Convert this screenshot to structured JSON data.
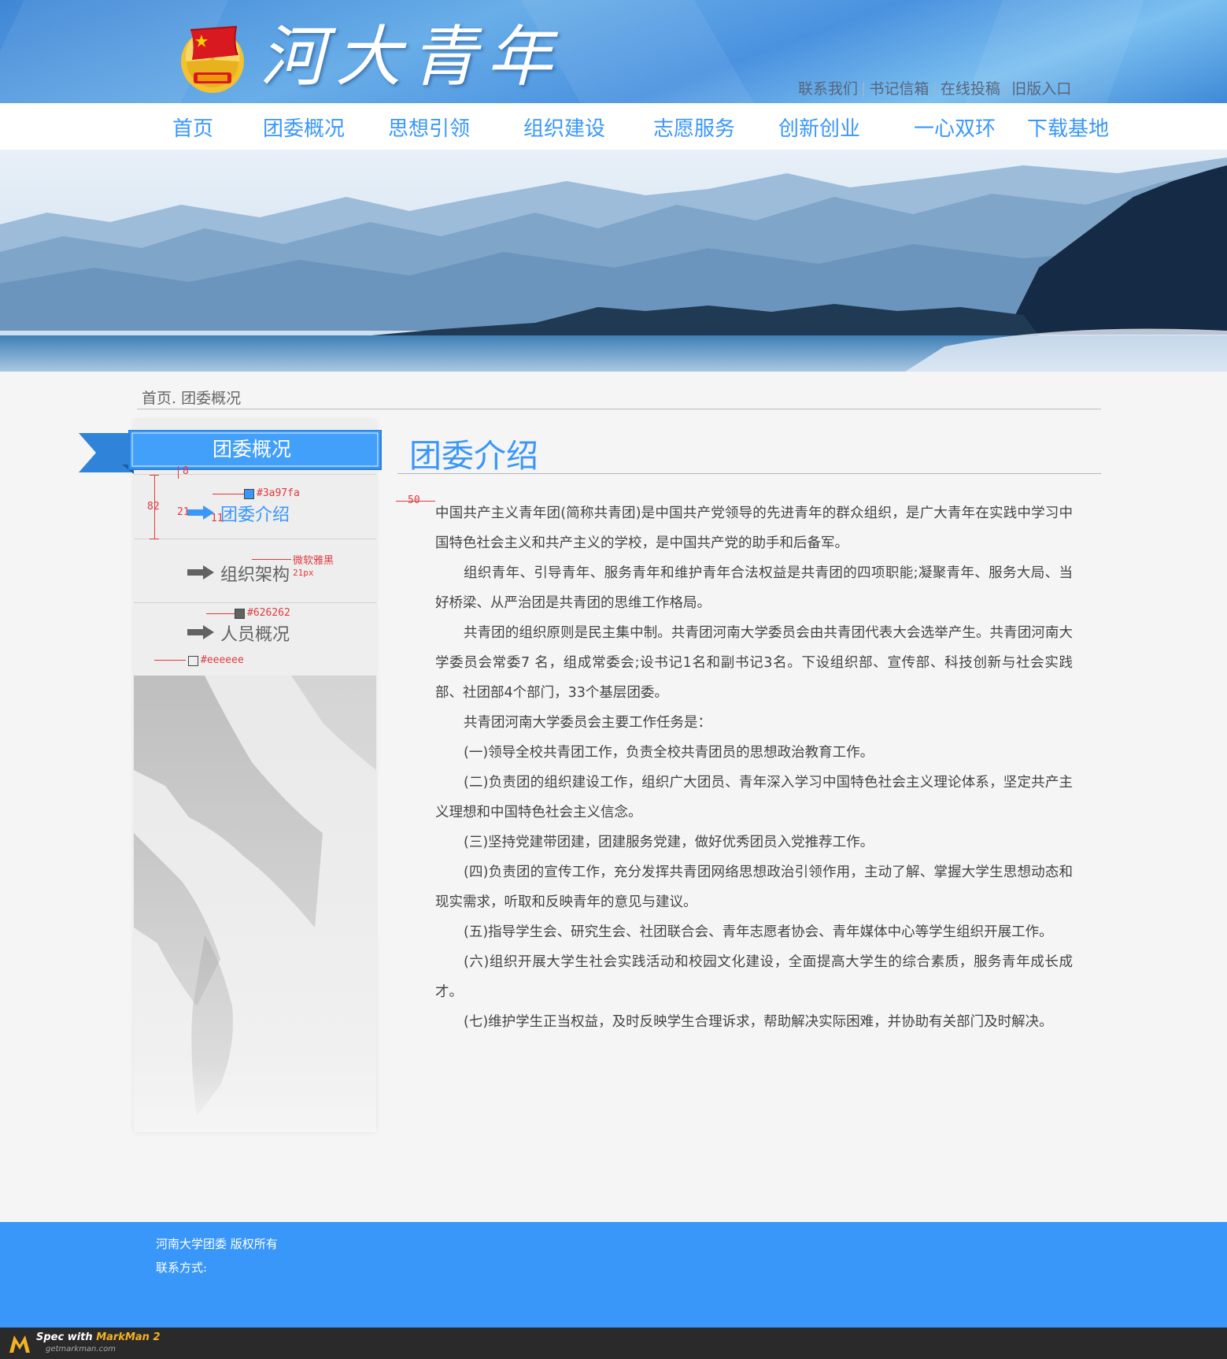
{
  "header": {
    "site_title": "河大青年",
    "top_links": [
      "联系我们",
      "书记信箱",
      "在线投稿",
      "旧版入口"
    ]
  },
  "nav": {
    "items": [
      "首页",
      "团委概况",
      "思想引领",
      "组织建设",
      "志愿服务",
      "创新创业",
      "一心双环",
      "下载基地"
    ]
  },
  "breadcrumb": "首页. 团委概况",
  "sidebar": {
    "title": "团委概况",
    "items": [
      {
        "label": "团委介绍",
        "active": true
      },
      {
        "label": "组织架构",
        "active": false
      },
      {
        "label": "人员概况",
        "active": false
      }
    ]
  },
  "spec_annotations": {
    "gap_top": "8",
    "item_height": "82",
    "arrow_left": "21",
    "arrow_gap": "11",
    "active_color": "#3a97fa",
    "font_name": "微软雅黑",
    "font_size": "21px",
    "text_color": "#626262",
    "bg_color": "#eeeeee",
    "content_indent": "50"
  },
  "content": {
    "title": "团委介绍",
    "paragraphs": [
      "中国共产主义青年团(简称共青团)是中国共产党领导的先进青年的群众组织，是广大青年在实践中学习中国特色社会主义和共产主义的学校，是中国共产党的助手和后备军。",
      "组织青年、引导青年、服务青年和维护青年合法权益是共青团的四项职能;凝聚青年、服务大局、当好桥梁、从严治团是共青团的思维工作格局。",
      "共青团的组织原则是民主集中制。共青团河南大学委员会由共青团代表大会选举产生。共青团河南大学委员会常委7 名，组成常委会;设书记1名和副书记3名。下设组织部、宣传部、科技创新与社会实践部、社团部4个部门，33个基层团委。",
      "共青团河南大学委员会主要工作任务是：",
      "(一)领导全校共青团工作，负责全校共青团员的思想政治教育工作。",
      "(二)负责团的组织建设工作，组织广大团员、青年深入学习中国特色社会主义理论体系，坚定共产主义理想和中国特色社会主义信念。",
      "(三)坚持党建带团建，团建服务党建，做好优秀团员入党推荐工作。",
      "(四)负责团的宣传工作，充分发挥共青团网络思想政治引领作用，主动了解、掌握大学生思想动态和现实需求，听取和反映青年的意见与建议。",
      "(五)指导学生会、研究生会、社团联合会、青年志愿者协会、青年媒体中心等学生组织开展工作。",
      "(六)组织开展大学生社会实践活动和校园文化建设，全面提高大学生的综合素质，服务青年成长成才。",
      "(七)维护学生正当权益，及时反映学生合理诉求，帮助解决实际困难，并协助有关部门及时解决。"
    ]
  },
  "footer": {
    "copyright": "河南大学团委  版权所有",
    "contact": "联系方式:"
  },
  "markman": {
    "spec_with": "Spec with ",
    "brand": "MarkMan 2",
    "url": "getmarkman.com"
  },
  "colors": {
    "accent": "#3a97fa",
    "text_gray": "#626262",
    "sidebar_bg": "#eeeeee",
    "footer_bg": "#3a97fa"
  }
}
